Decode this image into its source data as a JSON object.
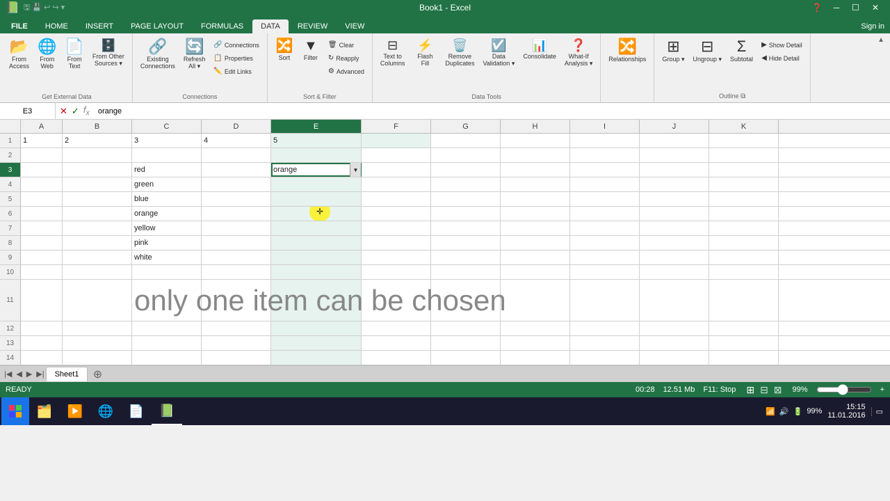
{
  "titlebar": {
    "title": "Book1 - Excel",
    "controls": [
      "─",
      "□",
      "✕"
    ]
  },
  "qat": {
    "buttons": [
      "💾",
      "↩",
      "↪",
      "▼"
    ]
  },
  "ribbon_tabs": [
    "FILE",
    "HOME",
    "INSERT",
    "PAGE LAYOUT",
    "FORMULAS",
    "DATA",
    "REVIEW",
    "VIEW"
  ],
  "active_tab": "DATA",
  "signin": "Sign in",
  "ribbon": {
    "groups": [
      {
        "label": "Get External Data",
        "items": [
          {
            "id": "from-access",
            "label": "From\nAccess",
            "icon": "📂"
          },
          {
            "id": "from-web",
            "label": "From\nWeb",
            "icon": "🌐"
          },
          {
            "id": "from-text",
            "label": "From\nText",
            "icon": "📄"
          },
          {
            "id": "from-other",
            "label": "From Other\nSources",
            "icon": "🗄️"
          }
        ]
      },
      {
        "label": "Connections",
        "items": [
          {
            "id": "existing-connections",
            "label": "Existing\nConnections",
            "icon": "🔗"
          },
          {
            "id": "refresh-all",
            "label": "Refresh\nAll",
            "icon": "🔄"
          }
        ],
        "small_items": [
          {
            "id": "connections",
            "label": "Connections"
          },
          {
            "id": "properties",
            "label": "Properties"
          },
          {
            "id": "edit-links",
            "label": "Edit Links"
          }
        ]
      },
      {
        "label": "Sort & Filter",
        "items": [
          {
            "id": "sort",
            "label": "Sort",
            "icon": "🔢"
          },
          {
            "id": "filter",
            "label": "Filter",
            "icon": "🔽"
          }
        ],
        "small_items": [
          {
            "id": "clear",
            "label": "Clear"
          },
          {
            "id": "reapply",
            "label": "Reapply"
          },
          {
            "id": "advanced",
            "label": "Advanced"
          }
        ]
      },
      {
        "label": "Data Tools",
        "items": [
          {
            "id": "text-to-cols",
            "label": "Text to\nColumns",
            "icon": "⊟"
          },
          {
            "id": "flash-fill",
            "label": "Flash\nFill",
            "icon": "⚡"
          },
          {
            "id": "remove-dupes",
            "label": "Remove\nDuplicates",
            "icon": "🗑️"
          },
          {
            "id": "data-validation",
            "label": "Data\nValidation",
            "icon": "✔️"
          },
          {
            "id": "consolidate",
            "label": "Consolidate",
            "icon": "📊"
          },
          {
            "id": "what-if",
            "label": "What-If\nAnalysis",
            "icon": "❓"
          }
        ]
      },
      {
        "label": "",
        "items": [
          {
            "id": "relationships",
            "label": "Relationships",
            "icon": "🔀"
          }
        ]
      },
      {
        "label": "Outline",
        "items": [
          {
            "id": "group",
            "label": "Group",
            "icon": "⊞"
          },
          {
            "id": "ungroup",
            "label": "Ungroup",
            "icon": "⊟"
          },
          {
            "id": "subtotal",
            "label": "Subtotal",
            "icon": "Σ"
          }
        ],
        "small_items": [
          {
            "id": "show-detail",
            "label": "Show Detail"
          },
          {
            "id": "hide-detail",
            "label": "Hide Detail"
          }
        ]
      }
    ]
  },
  "formula_bar": {
    "cell_ref": "E3",
    "value": "orange"
  },
  "columns": [
    "A",
    "B",
    "C",
    "D",
    "E",
    "F",
    "G",
    "H",
    "I",
    "J",
    "K"
  ],
  "selected_col": "E",
  "active_cell": "E3",
  "rows": [
    {
      "num": 1,
      "cells": {
        "A": "1",
        "B": "2",
        "C": "3",
        "D": "4",
        "E": "5"
      }
    },
    {
      "num": 2,
      "cells": {}
    },
    {
      "num": 3,
      "cells": {
        "C": "red",
        "E": "orange"
      }
    },
    {
      "num": 4,
      "cells": {
        "C": "green"
      }
    },
    {
      "num": 5,
      "cells": {
        "C": "blue"
      }
    },
    {
      "num": 6,
      "cells": {
        "C": "orange"
      }
    },
    {
      "num": 7,
      "cells": {
        "C": "yellow"
      }
    },
    {
      "num": 8,
      "cells": {
        "C": "pink"
      }
    },
    {
      "num": 9,
      "cells": {
        "C": "white"
      }
    },
    {
      "num": 10,
      "cells": {}
    },
    {
      "num": 11,
      "cells": {}
    },
    {
      "num": 12,
      "cells": {}
    },
    {
      "num": 13,
      "cells": {}
    },
    {
      "num": 14,
      "cells": {}
    }
  ],
  "big_text": "only one item can be chosen",
  "sheet_tabs": [
    "Sheet1"
  ],
  "active_sheet": "Sheet1",
  "status_bar": {
    "status": "READY",
    "time": "15:15",
    "date": "11.01.2016",
    "timer": "00:28",
    "size": "12.51 Mb",
    "key": "F11: Stop",
    "zoom": "99%"
  },
  "taskbar": {
    "apps": [
      "🪟",
      "🗂️",
      "▶️",
      "🌐",
      "📄",
      "📗"
    ]
  }
}
